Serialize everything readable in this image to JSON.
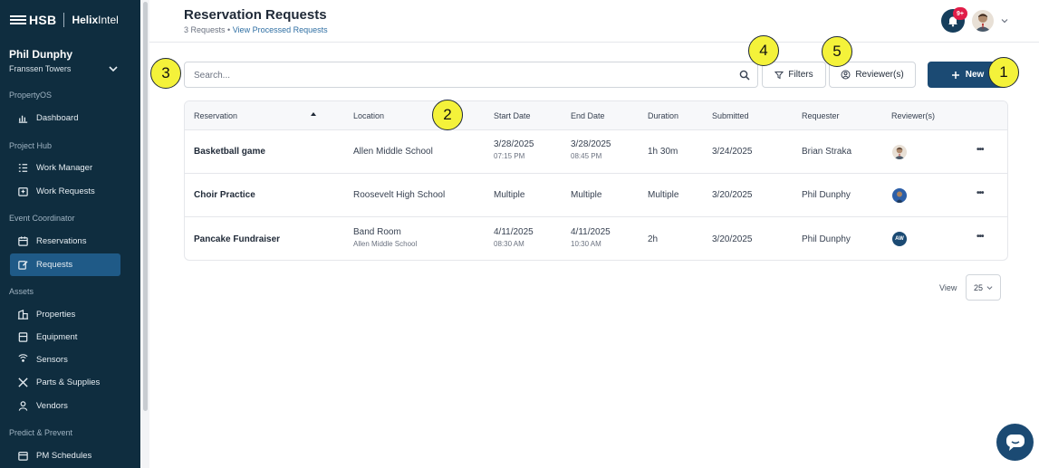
{
  "brand": {
    "logo_left": "HSB",
    "logo_right_bold": "Helix",
    "logo_right": "Intel"
  },
  "user": {
    "name": "Phil Dunphy",
    "site": "Franssen Towers"
  },
  "sidebar": {
    "sections": [
      {
        "label": "PropertyOS",
        "items": [
          {
            "label": "Dashboard",
            "icon": "dashboard-icon"
          }
        ]
      },
      {
        "label": "Project Hub",
        "items": [
          {
            "label": "Work Manager",
            "icon": "list-icon"
          },
          {
            "label": "Work Requests",
            "icon": "inbox-icon"
          }
        ]
      },
      {
        "label": "Event Coordinator",
        "items": [
          {
            "label": "Reservations",
            "icon": "calendar-icon"
          },
          {
            "label": "Requests",
            "icon": "edit-icon",
            "active": true
          }
        ]
      },
      {
        "label": "Assets",
        "items": [
          {
            "label": "Properties",
            "icon": "building-icon"
          },
          {
            "label": "Equipment",
            "icon": "equipment-icon"
          },
          {
            "label": "Sensors",
            "icon": "sensor-icon"
          },
          {
            "label": "Parts & Supplies",
            "icon": "tools-icon"
          },
          {
            "label": "Vendors",
            "icon": "vendor-icon"
          }
        ]
      },
      {
        "label": "Predict & Prevent",
        "items": [
          {
            "label": "PM Schedules",
            "icon": "schedule-icon"
          }
        ]
      }
    ]
  },
  "header": {
    "title": "Reservation Requests",
    "count": "3 Requests",
    "separator": "•",
    "link": "View Processed Requests",
    "notification_badge": "9+"
  },
  "toolbar": {
    "search_placeholder": "Search...",
    "filters_label": "Filters",
    "reviewers_label": "Reviewer(s)",
    "new_label": "New"
  },
  "table": {
    "columns": [
      "Reservation",
      "Location",
      "Start Date",
      "End Date",
      "Duration",
      "Submitted",
      "Requester",
      "Reviewer(s)"
    ],
    "rows": [
      {
        "reservation": "Basketball game",
        "location": "Allen Middle School",
        "location_sub": "",
        "start_date": "3/28/2025",
        "start_time": "07:15 PM",
        "end_date": "3/28/2025",
        "end_time": "08:45 PM",
        "duration": "1h 30m",
        "submitted": "3/24/2025",
        "requester": "Brian Straka",
        "reviewer": "photo"
      },
      {
        "reservation": "Choir Practice",
        "location": "Roosevelt High School",
        "location_sub": "",
        "start_date": "Multiple",
        "start_time": "",
        "end_date": "Multiple",
        "end_time": "",
        "duration": "Multiple",
        "submitted": "3/20/2025",
        "requester": "Phil Dunphy",
        "reviewer": "photo"
      },
      {
        "reservation": "Pancake Fundraiser",
        "location": "Band Room",
        "location_sub": "Allen Middle School",
        "start_date": "4/11/2025",
        "start_time": "08:30 AM",
        "end_date": "4/11/2025",
        "end_time": "10:30 AM",
        "duration": "2h",
        "submitted": "3/20/2025",
        "requester": "Phil Dunphy",
        "reviewer": "AW"
      }
    ],
    "more_label": "•••"
  },
  "pagination": {
    "view_label": "View",
    "page_size": "25"
  },
  "callouts": [
    "1",
    "2",
    "3",
    "4",
    "5"
  ],
  "colors": {
    "sidebar_bg": "#0f2d3f",
    "active_nav": "#1f5a87",
    "primary": "#1b4a73",
    "link": "#2f6fa3",
    "callout": "#f4f23a",
    "badge": "#e11d48"
  }
}
